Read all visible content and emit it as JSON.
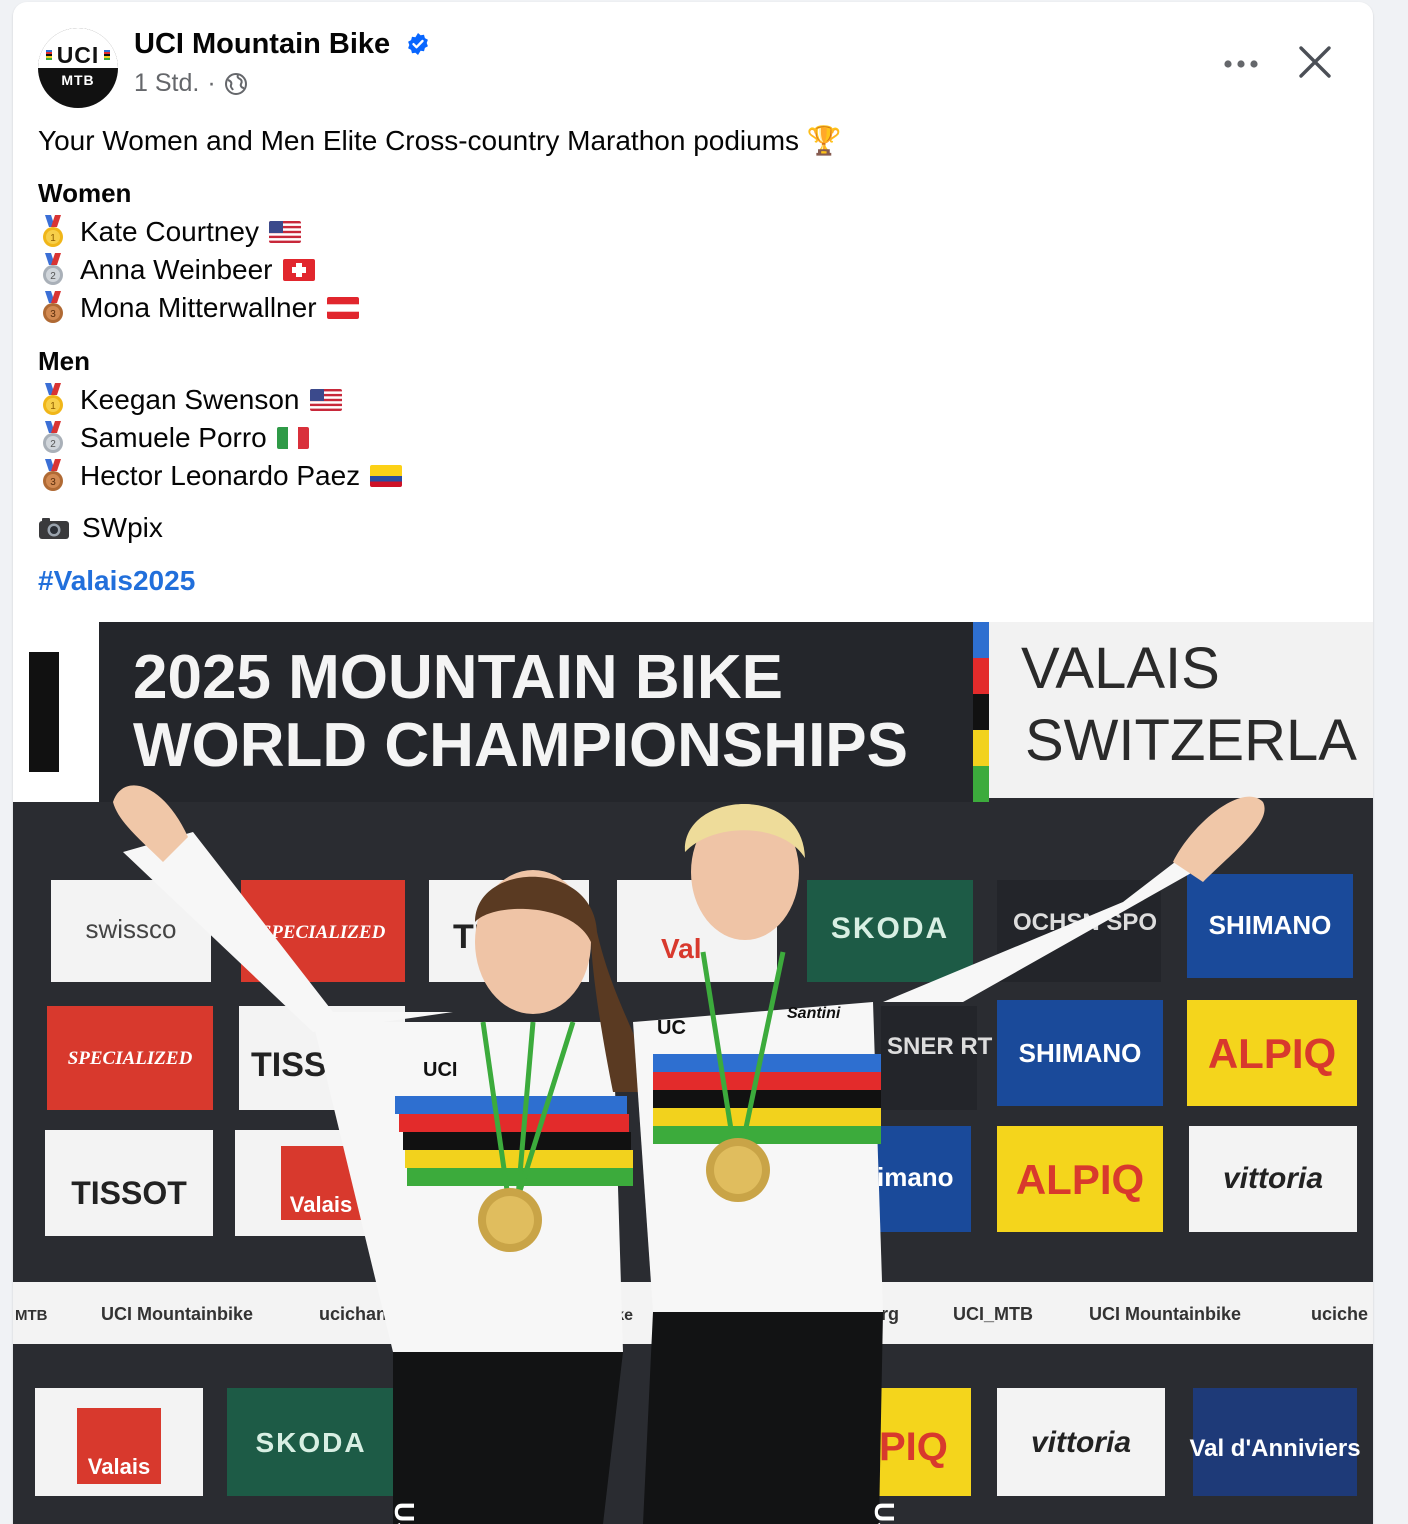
{
  "post": {
    "page_name": "UCI Mountain Bike",
    "timestamp": "1 Std.",
    "separator": "·",
    "avatar": {
      "logo_text": "UCI",
      "sub_text": "MTB"
    },
    "intro": "Your Women and Men Elite Cross-country Marathon podiums 🏆",
    "women_title": "Women",
    "women": [
      {
        "medal": "gold",
        "name": "Kate Courtney",
        "flag": "usa"
      },
      {
        "medal": "silver",
        "name": "Anna Weinbeer",
        "flag": "switzerland"
      },
      {
        "medal": "bronze",
        "name": "Mona Mitterwallner",
        "flag": "austria"
      }
    ],
    "men_title": "Men",
    "men": [
      {
        "medal": "gold",
        "name": "Keegan Swenson",
        "flag": "usa"
      },
      {
        "medal": "silver",
        "name": "Samuele Porro",
        "flag": "italy"
      },
      {
        "medal": "bronze",
        "name": "Hector Leonardo Paez",
        "flag": "colombia"
      }
    ],
    "photo_credit": "SWpix",
    "hashtag": "#Valais2025"
  },
  "photo": {
    "banner_line1": "2025 MOUNTAIN BIKE",
    "banner_line2": "WORLD CHAMPIONSHIPS",
    "location_line1": "VALAIS",
    "location_line2": "SWITZERLA",
    "sponsors": [
      "swissco",
      "SPECIALIZED",
      "TI",
      "Val",
      "SKODA",
      "OCHSN SPO",
      "SHIMANO",
      "TISS",
      "SNER RT",
      "ALPIQ",
      "TISSOT",
      "Valais",
      "imano",
      "vittoria",
      "SKODA",
      "PIQ",
      "Val d'Anniviers"
    ],
    "strip_items": [
      "MTB",
      "UCI Mountainbike",
      "ucichann",
      "bike",
      ".org",
      "UCI_MTB",
      "UCI Mountainbike",
      "uciche"
    ],
    "jersey_labels": [
      "UCI",
      "Santini",
      "USA",
      "UC",
      "USA"
    ]
  },
  "colors": {
    "link": "#216fdb",
    "verified": "#0866ff",
    "secondary_text": "#65676b",
    "rainbow": [
      "#2e6fd0",
      "#e32b2b",
      "#111111",
      "#f2d21d",
      "#3cab3c"
    ]
  },
  "icons": [
    "verified-badge-icon",
    "globe-icon",
    "more-icon",
    "close-icon",
    "trophy-emoji",
    "medal-icon",
    "flag-icon",
    "camera-icon"
  ]
}
